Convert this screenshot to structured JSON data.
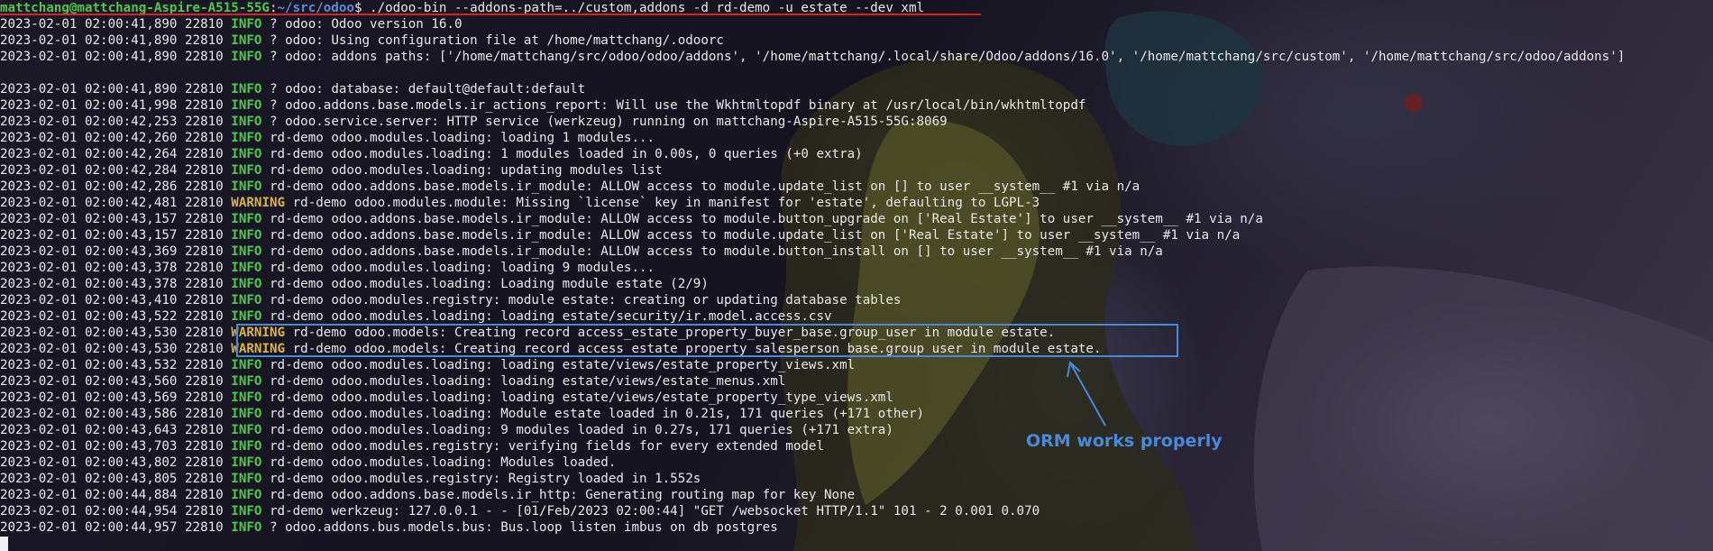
{
  "prompt": {
    "user_host": "mattchang@mattchang-Aspire-A515-55G",
    "separator": ":",
    "path": "~/src/odoo",
    "symbol": "$",
    "command": " ./odoo-bin --addons-path=../custom,addons -d rd-demo -u estate --dev xml"
  },
  "log_lines": [
    {
      "ts": "2023-02-01 02:00:41,890",
      "pid": "22810",
      "level": "INFO",
      "msg": "? odoo: Odoo version 16.0"
    },
    {
      "ts": "2023-02-01 02:00:41,890",
      "pid": "22810",
      "level": "INFO",
      "msg": "? odoo: Using configuration file at /home/mattchang/.odoorc"
    },
    {
      "ts": "2023-02-01 02:00:41,890",
      "pid": "22810",
      "level": "INFO",
      "msg": "? odoo: addons paths: ['/home/mattchang/src/odoo/odoo/addons', '/home/mattchang/.local/share/Odoo/addons/16.0', '/home/mattchang/src/custom', '/home/mattchang/src/odoo/addons']"
    },
    {
      "blank": true
    },
    {
      "ts": "2023-02-01 02:00:41,890",
      "pid": "22810",
      "level": "INFO",
      "msg": "? odoo: database: default@default:default"
    },
    {
      "ts": "2023-02-01 02:00:41,998",
      "pid": "22810",
      "level": "INFO",
      "msg": "? odoo.addons.base.models.ir_actions_report: Will use the Wkhtmltopdf binary at /usr/local/bin/wkhtmltopdf"
    },
    {
      "ts": "2023-02-01 02:00:42,253",
      "pid": "22810",
      "level": "INFO",
      "msg": "? odoo.service.server: HTTP service (werkzeug) running on mattchang-Aspire-A515-55G:8069"
    },
    {
      "ts": "2023-02-01 02:00:42,260",
      "pid": "22810",
      "level": "INFO",
      "msg": "rd-demo odoo.modules.loading: loading 1 modules..."
    },
    {
      "ts": "2023-02-01 02:00:42,264",
      "pid": "22810",
      "level": "INFO",
      "msg": "rd-demo odoo.modules.loading: 1 modules loaded in 0.00s, 0 queries (+0 extra)"
    },
    {
      "ts": "2023-02-01 02:00:42,284",
      "pid": "22810",
      "level": "INFO",
      "msg": "rd-demo odoo.modules.loading: updating modules list"
    },
    {
      "ts": "2023-02-01 02:00:42,286",
      "pid": "22810",
      "level": "INFO",
      "msg": "rd-demo odoo.addons.base.models.ir_module: ALLOW access to module.update_list on [] to user __system__ #1 via n/a"
    },
    {
      "ts": "2023-02-01 02:00:42,481",
      "pid": "22810",
      "level": "WARNING",
      "msg": "rd-demo odoo.modules.module: Missing `license` key in manifest for 'estate', defaulting to LGPL-3"
    },
    {
      "ts": "2023-02-01 02:00:43,157",
      "pid": "22810",
      "level": "INFO",
      "msg": "rd-demo odoo.addons.base.models.ir_module: ALLOW access to module.button_upgrade on ['Real Estate'] to user __system__ #1 via n/a"
    },
    {
      "ts": "2023-02-01 02:00:43,157",
      "pid": "22810",
      "level": "INFO",
      "msg": "rd-demo odoo.addons.base.models.ir_module: ALLOW access to module.update_list on ['Real Estate'] to user __system__ #1 via n/a"
    },
    {
      "ts": "2023-02-01 02:00:43,369",
      "pid": "22810",
      "level": "INFO",
      "msg": "rd-demo odoo.addons.base.models.ir_module: ALLOW access to module.button_install on [] to user __system__ #1 via n/a"
    },
    {
      "ts": "2023-02-01 02:00:43,378",
      "pid": "22810",
      "level": "INFO",
      "msg": "rd-demo odoo.modules.loading: loading 9 modules..."
    },
    {
      "ts": "2023-02-01 02:00:43,378",
      "pid": "22810",
      "level": "INFO",
      "msg": "rd-demo odoo.modules.loading: Loading module estate (2/9)"
    },
    {
      "ts": "2023-02-01 02:00:43,410",
      "pid": "22810",
      "level": "INFO",
      "msg": "rd-demo odoo.modules.registry: module estate: creating or updating database tables"
    },
    {
      "ts": "2023-02-01 02:00:43,522",
      "pid": "22810",
      "level": "INFO",
      "msg": "rd-demo odoo.modules.loading: loading estate/security/ir.model.access.csv"
    },
    {
      "ts": "2023-02-01 02:00:43,530",
      "pid": "22810",
      "level": "WARNING",
      "msg": "rd-demo odoo.models: Creating record access_estate_property_buyer_base.group_user in module estate."
    },
    {
      "ts": "2023-02-01 02:00:43,530",
      "pid": "22810",
      "level": "WARNING",
      "msg": "rd-demo odoo.models: Creating record access_estate_property_salesperson_base.group_user in module estate."
    },
    {
      "ts": "2023-02-01 02:00:43,532",
      "pid": "22810",
      "level": "INFO",
      "msg": "rd-demo odoo.modules.loading: loading estate/views/estate_property_views.xml"
    },
    {
      "ts": "2023-02-01 02:00:43,560",
      "pid": "22810",
      "level": "INFO",
      "msg": "rd-demo odoo.modules.loading: loading estate/views/estate_menus.xml"
    },
    {
      "ts": "2023-02-01 02:00:43,569",
      "pid": "22810",
      "level": "INFO",
      "msg": "rd-demo odoo.modules.loading: loading estate/views/estate_property_type_views.xml"
    },
    {
      "ts": "2023-02-01 02:00:43,586",
      "pid": "22810",
      "level": "INFO",
      "msg": "rd-demo odoo.modules.loading: Module estate loaded in 0.21s, 171 queries (+171 other)"
    },
    {
      "ts": "2023-02-01 02:00:43,643",
      "pid": "22810",
      "level": "INFO",
      "msg": "rd-demo odoo.modules.loading: 9 modules loaded in 0.27s, 171 queries (+171 extra)"
    },
    {
      "ts": "2023-02-01 02:00:43,703",
      "pid": "22810",
      "level": "INFO",
      "msg": "rd-demo odoo.modules.registry: verifying fields for every extended model"
    },
    {
      "ts": "2023-02-01 02:00:43,802",
      "pid": "22810",
      "level": "INFO",
      "msg": "rd-demo odoo.modules.loading: Modules loaded."
    },
    {
      "ts": "2023-02-01 02:00:43,805",
      "pid": "22810",
      "level": "INFO",
      "msg": "rd-demo odoo.modules.registry: Registry loaded in 1.552s"
    },
    {
      "ts": "2023-02-01 02:00:44,884",
      "pid": "22810",
      "level": "INFO",
      "msg": "rd-demo odoo.addons.base.models.ir_http: Generating routing map for key None"
    },
    {
      "ts": "2023-02-01 02:00:44,954",
      "pid": "22810",
      "level": "INFO",
      "msg": "rd-demo werkzeug: 127.0.0.1 - - [01/Feb/2023 02:00:44] \"GET /websocket HTTP/1.1\" 101 - 2 0.001 0.070"
    },
    {
      "ts": "2023-02-01 02:00:44,957",
      "pid": "22810",
      "level": "INFO",
      "msg": "? odoo.addons.bus.models.bus: Bus.loop listen imbus on db postgres"
    }
  ],
  "annotation": {
    "text": "ORM works properly"
  },
  "colors": {
    "info": "#4ec94e",
    "warning": "#d8b548",
    "path": "#5b8fd8",
    "annotation": "#4a88d8",
    "underline": "#e02020",
    "text": "#e8e8e8"
  }
}
